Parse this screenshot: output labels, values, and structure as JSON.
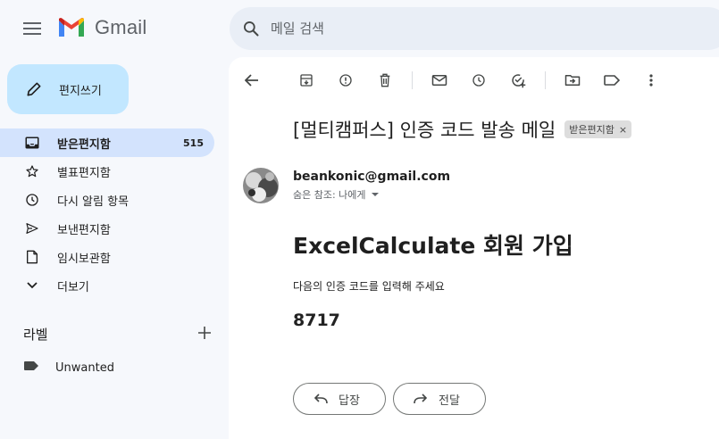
{
  "header": {
    "app_name": "Gmail",
    "search_placeholder": "메일 검색"
  },
  "sidebar": {
    "compose_label": "편지쓰기",
    "items": [
      {
        "label": "받은편지함",
        "count": "515",
        "icon": "inbox-icon"
      },
      {
        "label": "별표편지함",
        "count": "",
        "icon": "star-icon"
      },
      {
        "label": "다시 알림 항목",
        "count": "",
        "icon": "clock-icon"
      },
      {
        "label": "보낸편지함",
        "count": "",
        "icon": "send-icon"
      },
      {
        "label": "임시보관함",
        "count": "",
        "icon": "draft-icon"
      },
      {
        "label": "더보기",
        "count": "",
        "icon": "chevron-down-icon"
      }
    ],
    "labels_heading": "라벨",
    "labels": [
      {
        "label": "Unwanted",
        "icon": "label-icon"
      }
    ]
  },
  "email": {
    "subject": "[멀티캠퍼스] 인증 코드 발송 메일",
    "folder_chip": "받은편지함",
    "chip_close": "×",
    "sender": "beankonic@gmail.com",
    "recipients": "숨은 참조: 나에게",
    "title": "ExcelCalculate 회원 가입",
    "message": "다음의 인증 코드를 입력해 주세요",
    "code": "8717",
    "reply_label": "답장",
    "forward_label": "전달"
  },
  "colors": {
    "background": "#f6f8fc",
    "compose": "#c2e7ff",
    "active_nav": "#d3e3fd",
    "search": "#e9eef6"
  }
}
